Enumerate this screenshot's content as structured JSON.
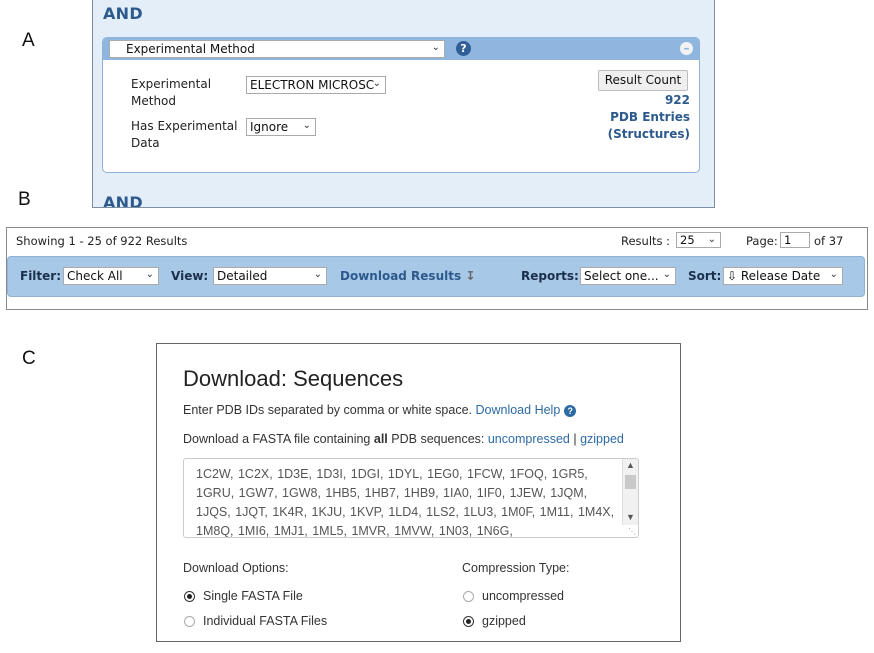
{
  "panel_labels": {
    "a": "A",
    "b": "B",
    "c": "C"
  },
  "query": {
    "and_label_top": "AND",
    "and_label_bottom": "AND",
    "field_select": "Experimental Method",
    "method_label": "Experimental Method",
    "method_value": "ELECTRON MICROSC",
    "has_data_label": "Has Experimental Data",
    "has_data_value": "Ignore",
    "result_count_button": "Result Count",
    "result_number": "922",
    "result_line1": "PDB Entries",
    "result_line2": "(Structures)"
  },
  "results_bar": {
    "showing": "Showing 1 - 25 of 922 Results",
    "results_label": "Results :",
    "results_per_page": "25",
    "page_label": "Page:",
    "page_value": "1",
    "of_pages": "of 37",
    "filter_label": "Filter:",
    "filter_value": "Check All",
    "view_label": "View:",
    "view_value": "Detailed",
    "download_results": "Download Results",
    "reports_label": "Reports:",
    "reports_value": "Select one...",
    "sort_label": "Sort:",
    "sort_value": "⇩ Release Date"
  },
  "download": {
    "title": "Download: Sequences",
    "instructions": "Enter PDB IDs separated by comma or white space.",
    "help_link": "Download Help",
    "fasta_prefix": "Download a FASTA file containing",
    "fasta_bold": "all",
    "fasta_suffix": "PDB sequences:",
    "uncompressed_link": "uncompressed",
    "separator": "|",
    "gzipped_link": "gzipped",
    "ids_text": "1C2W, 1C2X, 1D3E, 1D3I, 1DGI, 1DYL, 1EG0, 1FCW, 1FOQ, 1GR5, 1GRU, 1GW7, 1GW8, 1HB5, 1HB7, 1HB9, 1IA0, 1IF0, 1JEW, 1JQM, 1JQS, 1JQT, 1K4R, 1KJU, 1KVP, 1LD4, 1LS2, 1LU3, 1M0F, 1M11, 1M4X, 1M8Q, 1MI6, 1MJ1, 1ML5, 1MVR, 1MVW, 1N03, 1N6G,",
    "options_label": "Download Options:",
    "option_single": "Single FASTA File",
    "option_individual": "Individual FASTA Files",
    "compression_label": "Compression Type:",
    "compression_uncompressed": "uncompressed",
    "compression_gzipped": "gzipped"
  }
}
